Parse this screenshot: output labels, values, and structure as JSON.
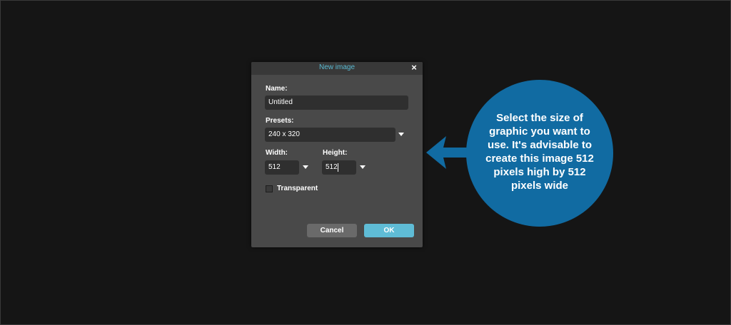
{
  "dialog": {
    "title": "New image",
    "close_symbol": "×",
    "name_label": "Name:",
    "name_value": "Untitled",
    "presets_label": "Presets:",
    "presets_value": "240 x 320",
    "width_label": "Width:",
    "width_value": "512",
    "height_label": "Height:",
    "height_value": "512",
    "transparent_label": "Transparent",
    "transparent_checked": false,
    "cancel_label": "Cancel",
    "ok_label": "OK"
  },
  "callout": {
    "text": "Select the size of graphic you want to use. It's advisable to create this image 512 pixels high by 512 pixels wide",
    "arrow_icon": "left-arrow-icon"
  },
  "colors": {
    "background": "#151515",
    "dialog": "#494949",
    "titlebar": "#383838",
    "accent": "#5fbcd6",
    "callout": "#116ba2"
  }
}
